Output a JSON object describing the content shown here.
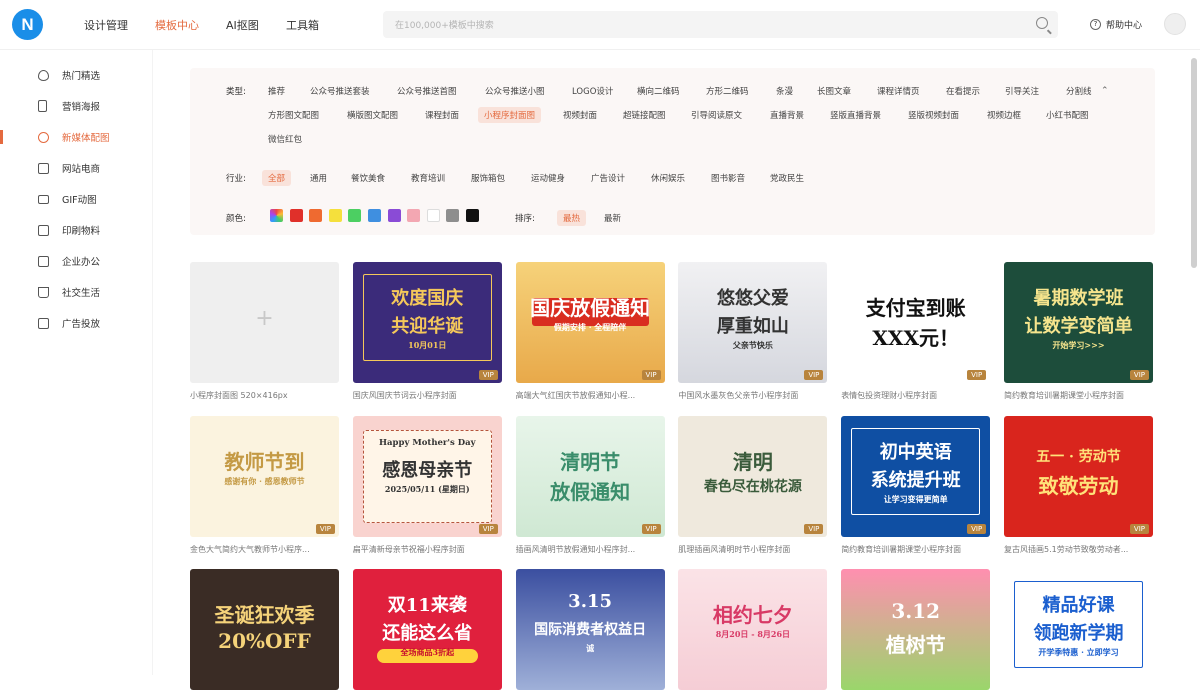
{
  "header": {
    "logo_letter": "N",
    "nav": [
      "设计管理",
      "模板中心",
      "AI抠图",
      "工具箱"
    ],
    "active_nav": "模板中心",
    "search_placeholder": "在100,000+模板中搜索",
    "help_label": "帮助中心"
  },
  "sidebar": {
    "items": [
      {
        "label": "热门精选",
        "icon": "fire-icon"
      },
      {
        "label": "营销海报",
        "icon": "poster-icon"
      },
      {
        "label": "新媒体配图",
        "icon": "chat-icon",
        "active": true
      },
      {
        "label": "网站电商",
        "icon": "shop-icon"
      },
      {
        "label": "GIF动图",
        "icon": "gif-icon"
      },
      {
        "label": "印刷物料",
        "icon": "print-icon"
      },
      {
        "label": "企业办公",
        "icon": "office-icon"
      },
      {
        "label": "社交生活",
        "icon": "cup-icon"
      },
      {
        "label": "广告投放",
        "icon": "ad-icon"
      }
    ]
  },
  "filters": {
    "type_label": "类型:",
    "types_row1": [
      "推荐",
      "公众号推送套装",
      "公众号推送首图",
      "公众号推送小图",
      "LOGO设计",
      "横向二维码",
      "方形二维码",
      "条漫",
      "长图文章",
      "课程详情页",
      "在看提示",
      "引导关注",
      "分割线"
    ],
    "types_row2": [
      "方形图文配图",
      "横版图文配图",
      "课程封面",
      "小程序封面图",
      "视频封面",
      "超链接配图",
      "引导阅读原文",
      "直播背景",
      "竖版直播背景",
      "竖版视频封面",
      "视频边框",
      "小红书配图"
    ],
    "types_row3": [
      "微信红包"
    ],
    "selected_type": "小程序封面图",
    "industry_label": "行业:",
    "industries": [
      "全部",
      "通用",
      "餐饮美食",
      "教育培训",
      "服饰箱包",
      "运动健身",
      "广告设计",
      "休闲娱乐",
      "图书影音",
      "党政民生"
    ],
    "selected_industry": "全部",
    "color_label": "颜色:",
    "colors": [
      "#ec5148",
      "#e0302a",
      "#ef6a30",
      "#f5e03c",
      "#4ccf62",
      "#3f8fe0",
      "#8a4bd6",
      "#f3a7b2",
      "#ffffff",
      "#8e8e8e",
      "#111111"
    ],
    "sort_label": "排序:",
    "sorts": [
      "最热",
      "最新"
    ],
    "selected_sort": "最热"
  },
  "templates": [
    {
      "caption": "小程序封面图 520×416px",
      "lines": [
        "+"
      ],
      "vip": false
    },
    {
      "caption": "国庆风国庆节词云小程序封面",
      "lines": [
        "欢度国庆",
        "共迎华诞",
        "10月01日"
      ],
      "vip": true
    },
    {
      "caption": "高端大气红国庆节放假通知小程...",
      "lines": [
        "国庆放假通知",
        "假期安排 · 全程陪伴"
      ],
      "vip": true
    },
    {
      "caption": "中国风水墨灰色父亲节小程序封面",
      "lines": [
        "悠悠父爱",
        "厚重如山",
        "父亲节快乐"
      ],
      "vip": true
    },
    {
      "caption": "表情包投资理财小程序封面",
      "lines": [
        "支付宝到账",
        "XXX元！"
      ],
      "vip": true
    },
    {
      "caption": "简约教育培训暑期课堂小程序封面",
      "lines": [
        "暑期数学班",
        "让数学变简单",
        "开始学习>>>"
      ],
      "vip": true
    },
    {
      "caption": "金色大气简约大气教师节小程序...",
      "lines": [
        "教师节到",
        "感谢有你 · 感恩教师节"
      ],
      "vip": true
    },
    {
      "caption": "扁平清新母亲节祝福小程序封面",
      "lines": [
        "Happy Mother's Day",
        "感恩母亲节",
        "2025/05/11 (星期日)"
      ],
      "vip": true
    },
    {
      "caption": "插画风清明节放假通知小程序封...",
      "lines": [
        "清明节",
        "放假通知"
      ],
      "vip": true
    },
    {
      "caption": "肌理插画风清明时节小程序封面",
      "lines": [
        "清明",
        "春色尽在桃花源"
      ],
      "vip": true
    },
    {
      "caption": "简约教育培训暑期课堂小程序封面",
      "lines": [
        "初中英语",
        "系统提升班",
        "让学习变得更简单"
      ],
      "vip": true
    },
    {
      "caption": "复古风插画5.1劳动节致敬劳动者...",
      "lines": [
        "五一 · 劳动节",
        "致敬劳动"
      ],
      "vip": true
    },
    {
      "caption": "",
      "lines": [
        "圣诞狂欢季",
        "20%OFF"
      ],
      "vip": false
    },
    {
      "caption": "",
      "lines": [
        "双11来袭",
        "还能这么省",
        "全场商品3折起"
      ],
      "vip": false
    },
    {
      "caption": "",
      "lines": [
        "3.15",
        "国际消费者权益日",
        "诚"
      ],
      "vip": false
    },
    {
      "caption": "",
      "lines": [
        "相约七夕",
        "8月20日 - 8月26日"
      ],
      "vip": false
    },
    {
      "caption": "",
      "lines": [
        "3.12",
        "植树节"
      ],
      "vip": false
    },
    {
      "caption": "",
      "lines": [
        "精品好课",
        "领跑新学期",
        "开学季特惠 · 立即学习"
      ],
      "vip": false
    }
  ],
  "vip_label": "VIP"
}
